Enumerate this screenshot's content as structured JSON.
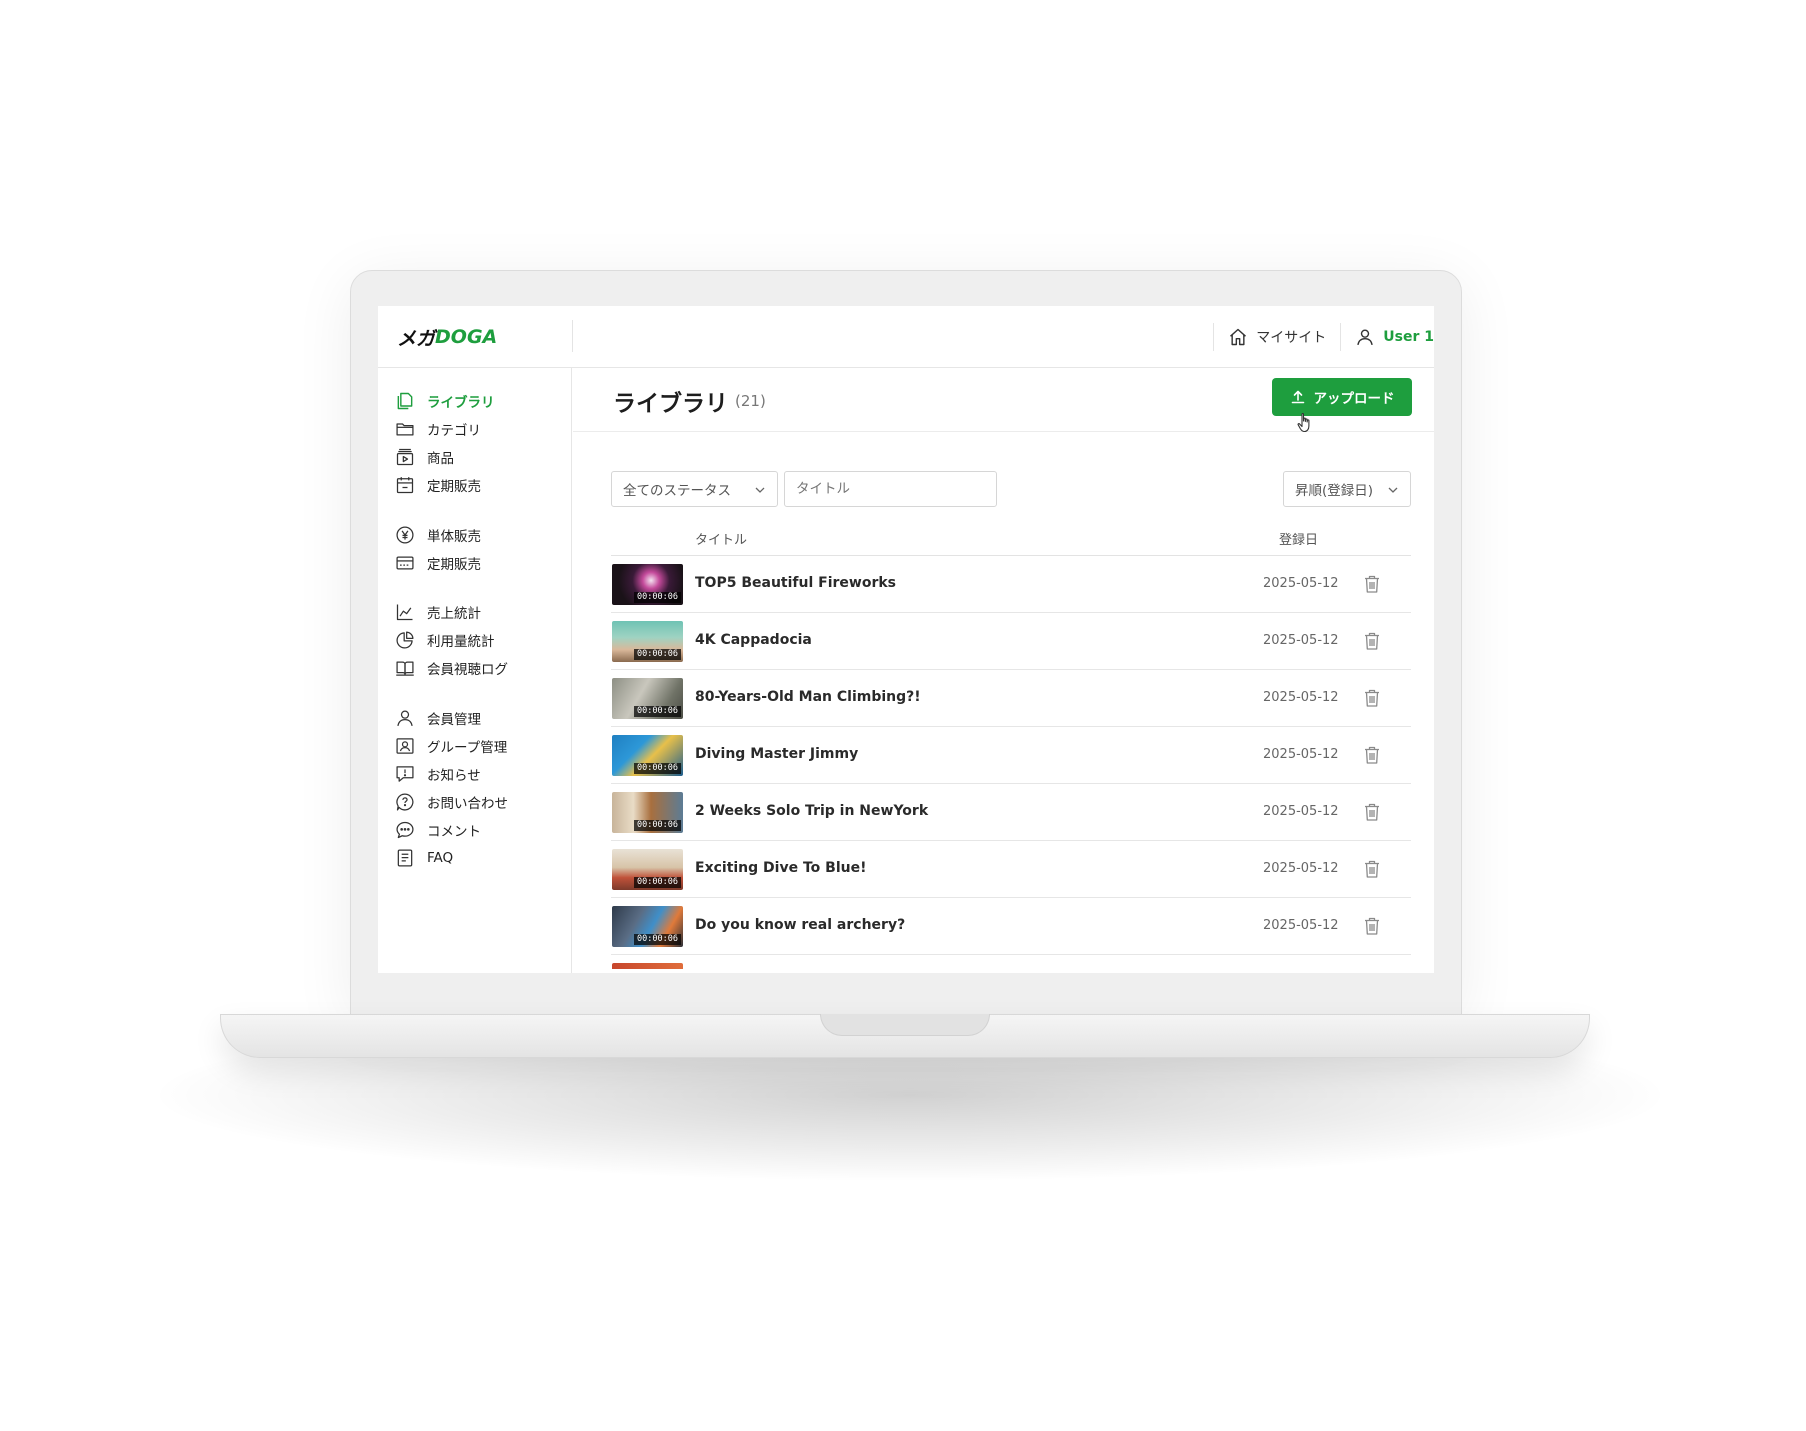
{
  "header": {
    "logo_katakana": "メガ",
    "logo_latin": "DOGA",
    "mysite_label": "マイサイト",
    "user_label": "User 1"
  },
  "sidebar": {
    "items": [
      {
        "label": "ライブラリ",
        "icon": "library-icon",
        "active": true
      },
      {
        "label": "カテゴリ",
        "icon": "folder-icon"
      },
      {
        "label": "商品",
        "icon": "video-product-icon"
      },
      {
        "label": "定期販売",
        "icon": "calendar-icon"
      },
      {
        "label": "単体販売",
        "icon": "yen-icon"
      },
      {
        "label": "定期販売",
        "icon": "credit-card-icon"
      },
      {
        "label": "売上統計",
        "icon": "line-chart-icon"
      },
      {
        "label": "利用量統計",
        "icon": "pie-chart-icon"
      },
      {
        "label": "会員視聴ログ",
        "icon": "book-icon"
      },
      {
        "label": "会員管理",
        "icon": "user-icon"
      },
      {
        "label": "グループ管理",
        "icon": "group-card-icon"
      },
      {
        "label": "お知らせ",
        "icon": "notice-icon"
      },
      {
        "label": "お問い合わせ",
        "icon": "question-icon"
      },
      {
        "label": "コメント",
        "icon": "comment-icon"
      },
      {
        "label": "FAQ",
        "icon": "document-icon"
      }
    ]
  },
  "main": {
    "title": "ライブラリ",
    "count": "(21)",
    "upload_label": "アップロード",
    "filters": {
      "status_value": "全てのステータス",
      "title_placeholder": "タイトル",
      "sort_value": "昇順(登録日)"
    },
    "columns": {
      "title": "タイトル",
      "date": "登録日"
    },
    "rows": [
      {
        "title": "TOP5 Beautiful Fireworks",
        "date": "2025-05-12",
        "duration": "00:00:06"
      },
      {
        "title": "4K Cappadocia",
        "date": "2025-05-12",
        "duration": "00:00:06"
      },
      {
        "title": "80-Years-Old Man Climbing?!",
        "date": "2025-05-12",
        "duration": "00:00:06"
      },
      {
        "title": "Diving Master Jimmy",
        "date": "2025-05-12",
        "duration": "00:00:06"
      },
      {
        "title": "2 Weeks Solo Trip in NewYork",
        "date": "2025-05-12",
        "duration": "00:00:06"
      },
      {
        "title": "Exciting Dive To Blue!",
        "date": "2025-05-12",
        "duration": "00:00:06"
      },
      {
        "title": "Do you know real archery?",
        "date": "2025-05-12",
        "duration": "00:00:06"
      }
    ]
  },
  "colors": {
    "accent": "#1e9e3e"
  }
}
